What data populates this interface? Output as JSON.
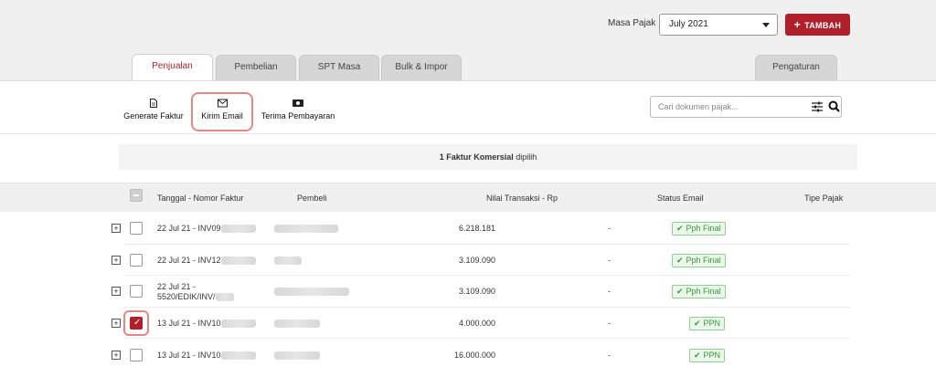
{
  "header": {
    "masa_pajak_label": "Masa Pajak",
    "masa_pajak_value": "July  2021",
    "tambah_label": "TAMBAH",
    "accent_color": "#b0202a"
  },
  "tabs": [
    {
      "label": "Penjualan",
      "active": true
    },
    {
      "label": "Pembelian",
      "active": false
    },
    {
      "label": "SPT Masa",
      "active": false
    },
    {
      "label": "Bulk & Impor",
      "active": false
    },
    {
      "label": "Pengaturan",
      "active": false
    }
  ],
  "actions": [
    {
      "label": "Generate Faktur",
      "icon": "document-icon"
    },
    {
      "label": "Kirim Email",
      "icon": "envelope-icon"
    },
    {
      "label": "Terima Pembayaran",
      "icon": "money-icon"
    }
  ],
  "search": {
    "placeholder": "Cari dokumen pajak..."
  },
  "selection": {
    "bold": "1 Faktur Komersial",
    "rest": " dipilih"
  },
  "table": {
    "columns": [
      "Tanggal - Nomor Faktur",
      "Pembeli",
      "Nilai Transaksi - Rp",
      "Status Email",
      "Tipe Pajak"
    ],
    "rows": [
      {
        "tanggal": "22 Jul 21 - INV09",
        "tanggal2": "",
        "nilai": "6.218.181",
        "status": "-",
        "tipe": "Pph Final",
        "checked": false
      },
      {
        "tanggal": "22 Jul 21 - INV12",
        "tanggal2": "",
        "nilai": "3.109.090",
        "status": "-",
        "tipe": "Pph Final",
        "checked": false
      },
      {
        "tanggal": "22 Jul 21 -",
        "tanggal2": "5520/EDIK/INV/",
        "nilai": "3.109.090",
        "status": "-",
        "tipe": "Pph Final",
        "checked": false
      },
      {
        "tanggal": "13 Jul 21 - INV10",
        "tanggal2": "",
        "nilai": "4.000.000",
        "status": "-",
        "tipe": "PPN",
        "checked": true
      },
      {
        "tanggal": "13 Jul 21 - INV10",
        "tanggal2": "",
        "nilai": "16.000.000",
        "status": "-",
        "tipe": "PPN",
        "checked": false
      }
    ]
  }
}
